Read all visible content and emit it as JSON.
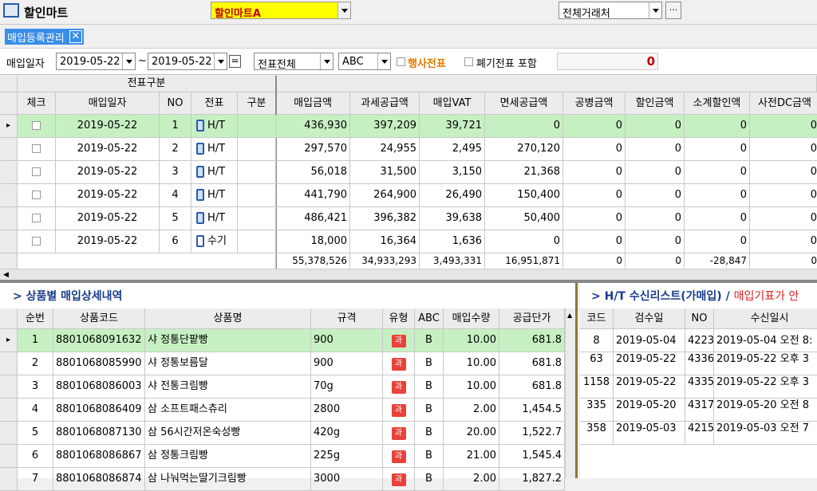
{
  "app": {
    "title": "할인마트"
  },
  "header": {
    "store": "할인마트A",
    "vendor": "전체거래처",
    "more": "···"
  },
  "tab": {
    "label": "매입등록관리"
  },
  "filter": {
    "date_label": "매입일자",
    "date_from": "2019-05-22",
    "tilde": "~",
    "date_to": "2019-05-22",
    "eq": "=",
    "slip_type": "전표전체",
    "abc": "ABC",
    "event_label": "행사전표",
    "discard_label": "폐기전표 포함",
    "count": "0"
  },
  "top_grid": {
    "group_header": "전표구분",
    "columns": [
      "체크",
      "매입일자",
      "NO",
      "전표",
      "구분",
      "매입금액",
      "과세공급액",
      "매입VAT",
      "면세공급액",
      "공병금액",
      "할인금액",
      "소계할인액",
      "사전DC금액"
    ],
    "rows": [
      {
        "date": "2019-05-22",
        "no": "1",
        "slip": "H/T",
        "div": "",
        "amount": "436,930",
        "taxable": "397,209",
        "vat": "39,721",
        "exempt": "0",
        "bottle": "0",
        "disc": "0",
        "subdisc": "0",
        "predc": "0"
      },
      {
        "date": "2019-05-22",
        "no": "2",
        "slip": "H/T",
        "div": "",
        "amount": "297,570",
        "taxable": "24,955",
        "vat": "2,495",
        "exempt": "270,120",
        "bottle": "0",
        "disc": "0",
        "subdisc": "0",
        "predc": "0"
      },
      {
        "date": "2019-05-22",
        "no": "3",
        "slip": "H/T",
        "div": "",
        "amount": "56,018",
        "taxable": "31,500",
        "vat": "3,150",
        "exempt": "21,368",
        "bottle": "0",
        "disc": "0",
        "subdisc": "0",
        "predc": "0"
      },
      {
        "date": "2019-05-22",
        "no": "4",
        "slip": "H/T",
        "div": "",
        "amount": "441,790",
        "taxable": "264,900",
        "vat": "26,490",
        "exempt": "150,400",
        "bottle": "0",
        "disc": "0",
        "subdisc": "0",
        "predc": "0"
      },
      {
        "date": "2019-05-22",
        "no": "5",
        "slip": "H/T",
        "div": "",
        "amount": "486,421",
        "taxable": "396,382",
        "vat": "39,638",
        "exempt": "50,400",
        "bottle": "0",
        "disc": "0",
        "subdisc": "0",
        "predc": "0"
      },
      {
        "date": "2019-05-22",
        "no": "6",
        "slip": "수기",
        "div": "",
        "amount": "18,000",
        "taxable": "16,364",
        "vat": "1,636",
        "exempt": "0",
        "bottle": "0",
        "disc": "0",
        "subdisc": "0",
        "predc": "0"
      }
    ],
    "totals": {
      "amount": "55,378,526",
      "taxable": "34,933,293",
      "vat": "3,493,331",
      "exempt": "16,951,871",
      "bottle": "0",
      "disc": "0",
      "subdisc": "-28,847",
      "predc": "0"
    }
  },
  "detail": {
    "title": "> 상품별 매입상세내역",
    "columns": [
      "순번",
      "상품코드",
      "상품명",
      "규격",
      "유형",
      "ABC",
      "매입수량",
      "공급단가"
    ],
    "type_tag": "과",
    "rows": [
      {
        "seq": "1",
        "code": "8801068091632",
        "name": "샤  정통단팥빵",
        "spec": "900",
        "abc": "B",
        "qty": "10.00",
        "price": "681.8"
      },
      {
        "seq": "2",
        "code": "8801068085990",
        "name": "샤  정통보름달",
        "spec": "900",
        "abc": "B",
        "qty": "10.00",
        "price": "681.8"
      },
      {
        "seq": "3",
        "code": "8801068086003",
        "name": "샤  전통크림빵",
        "spec": "70g",
        "abc": "B",
        "qty": "10.00",
        "price": "681.8"
      },
      {
        "seq": "4",
        "code": "8801068086409",
        "name": "삼  소프트패스츄리",
        "spec": "2800",
        "abc": "B",
        "qty": "2.00",
        "price": "1,454.5"
      },
      {
        "seq": "5",
        "code": "8801068087130",
        "name": "삼  56시간저온숙성빵",
        "spec": "420g",
        "abc": "B",
        "qty": "20.00",
        "price": "1,522.7"
      },
      {
        "seq": "6",
        "code": "8801068086867",
        "name": "삼  정통크림빵",
        "spec": "225g",
        "abc": "B",
        "qty": "21.00",
        "price": "1,545.4"
      },
      {
        "seq": "7",
        "code": "8801068086874",
        "name": "삼  나눠먹는딸기크림빵",
        "spec": "3000",
        "abc": "B",
        "qty": "2.00",
        "price": "1,827.2"
      }
    ]
  },
  "ht": {
    "title_main": "> H/T 수신리스트(가매입) / ",
    "title_red": "매입기표가 안",
    "columns": [
      "코드",
      "검수일",
      "NO",
      "수신일시"
    ],
    "rows": [
      {
        "code": "8",
        "date": "2019-05-04",
        "no": "4223",
        "recv": "2019-05-04 오전 8:"
      },
      {
        "code": "63",
        "date": "2019-05-22",
        "no": "4336",
        "recv": "2019-05-22 오후 3"
      },
      {
        "code": "1158",
        "date": "2019-05-22",
        "no": "4335",
        "recv": "2019-05-22 오후 3"
      },
      {
        "code": "335",
        "date": "2019-05-20",
        "no": "4317",
        "recv": "2019-05-20 오전 8"
      },
      {
        "code": "358",
        "date": "2019-05-03",
        "no": "4215",
        "recv": "2019-05-03 오전 7"
      }
    ]
  },
  "colors": {
    "selected": "#c7f0c2",
    "store_bg": "#ffff00",
    "store_text": "#c00000",
    "accent": "#1a3c8c"
  }
}
